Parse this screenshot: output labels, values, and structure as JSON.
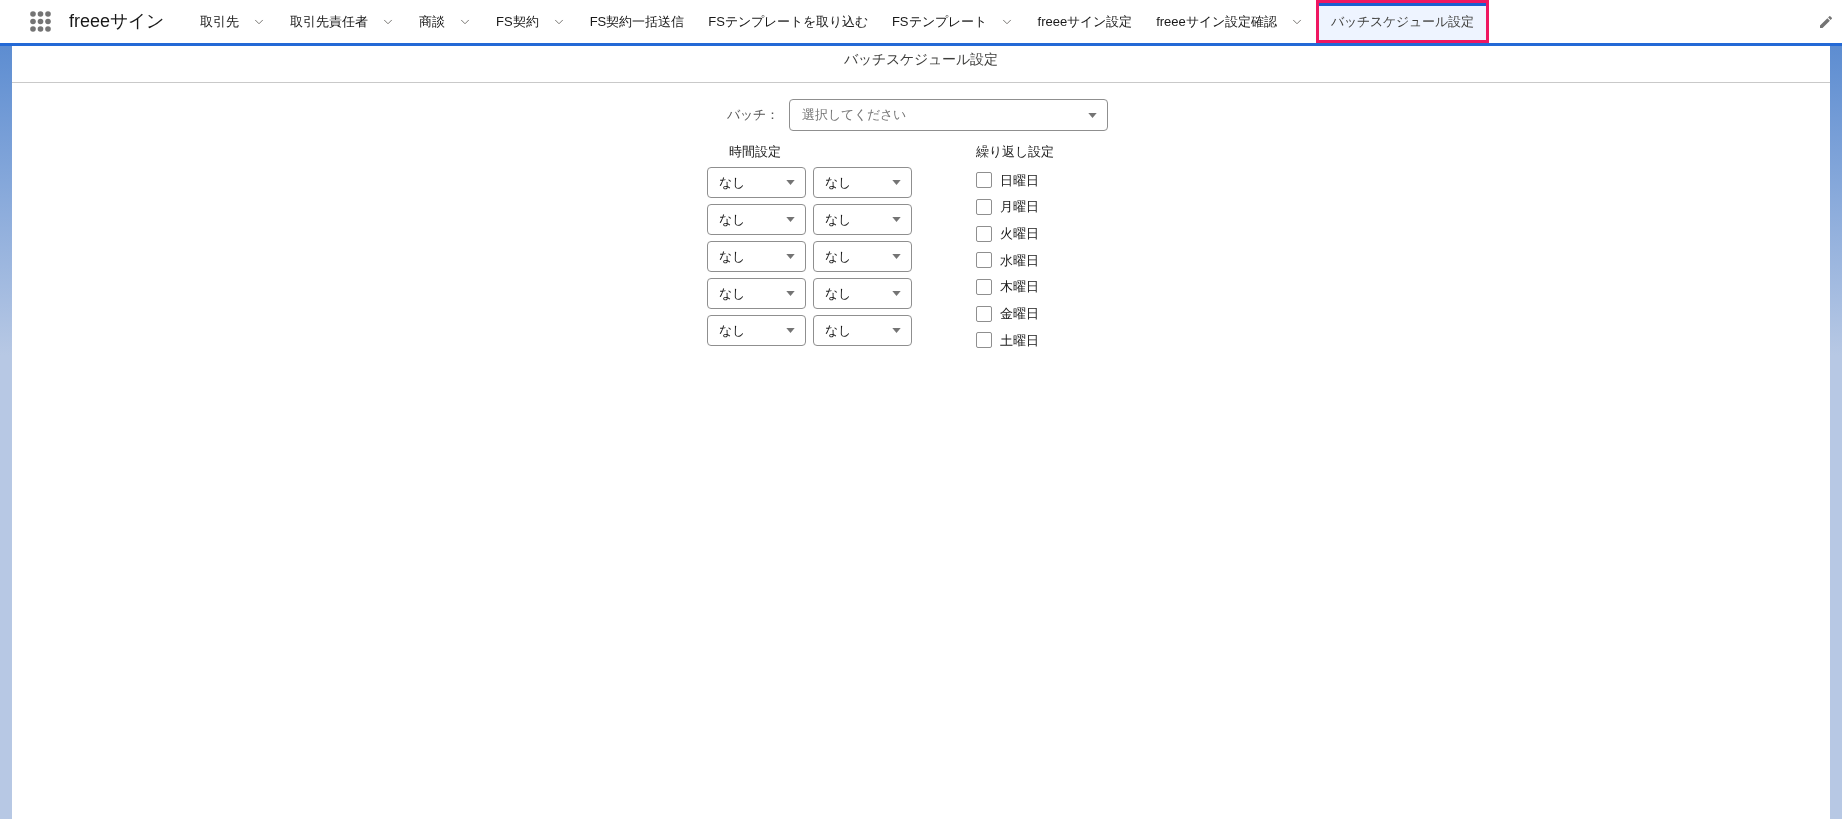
{
  "app": {
    "name": "freeeサイン"
  },
  "nav": [
    {
      "label": "取引先",
      "has_menu": true,
      "selected": false,
      "highlighted": false
    },
    {
      "label": "取引先責任者",
      "has_menu": true,
      "selected": false,
      "highlighted": false
    },
    {
      "label": "商談",
      "has_menu": true,
      "selected": false,
      "highlighted": false
    },
    {
      "label": "FS契約",
      "has_menu": true,
      "selected": false,
      "highlighted": false
    },
    {
      "label": "FS契約一括送信",
      "has_menu": false,
      "selected": false,
      "highlighted": false
    },
    {
      "label": "FSテンプレートを取り込む",
      "has_menu": false,
      "selected": false,
      "highlighted": false
    },
    {
      "label": "FSテンプレート",
      "has_menu": true,
      "selected": false,
      "highlighted": false
    },
    {
      "label": "freeeサイン設定",
      "has_menu": false,
      "selected": false,
      "highlighted": false
    },
    {
      "label": "freeeサイン設定確認",
      "has_menu": true,
      "selected": false,
      "highlighted": false
    },
    {
      "label": "バッチスケジュール設定",
      "has_menu": false,
      "selected": true,
      "highlighted": true
    }
  ],
  "page": {
    "title": "バッチスケジュール設定"
  },
  "batch": {
    "label": "バッチ：",
    "placeholder": "選択してください"
  },
  "time_settings": {
    "label": "時間設定",
    "rows": [
      {
        "values": [
          "なし",
          "なし"
        ]
      },
      {
        "values": [
          "なし",
          "なし"
        ]
      },
      {
        "values": [
          "なし",
          "なし"
        ]
      },
      {
        "values": [
          "なし",
          "なし"
        ]
      },
      {
        "values": [
          "なし",
          "なし"
        ]
      }
    ]
  },
  "repeat_settings": {
    "label": "繰り返し設定",
    "days": [
      {
        "label": "日曜日",
        "checked": false
      },
      {
        "label": "月曜日",
        "checked": false
      },
      {
        "label": "火曜日",
        "checked": false
      },
      {
        "label": "水曜日",
        "checked": false
      },
      {
        "label": "木曜日",
        "checked": false
      },
      {
        "label": "金曜日",
        "checked": false
      },
      {
        "label": "土曜日",
        "checked": false
      }
    ]
  }
}
